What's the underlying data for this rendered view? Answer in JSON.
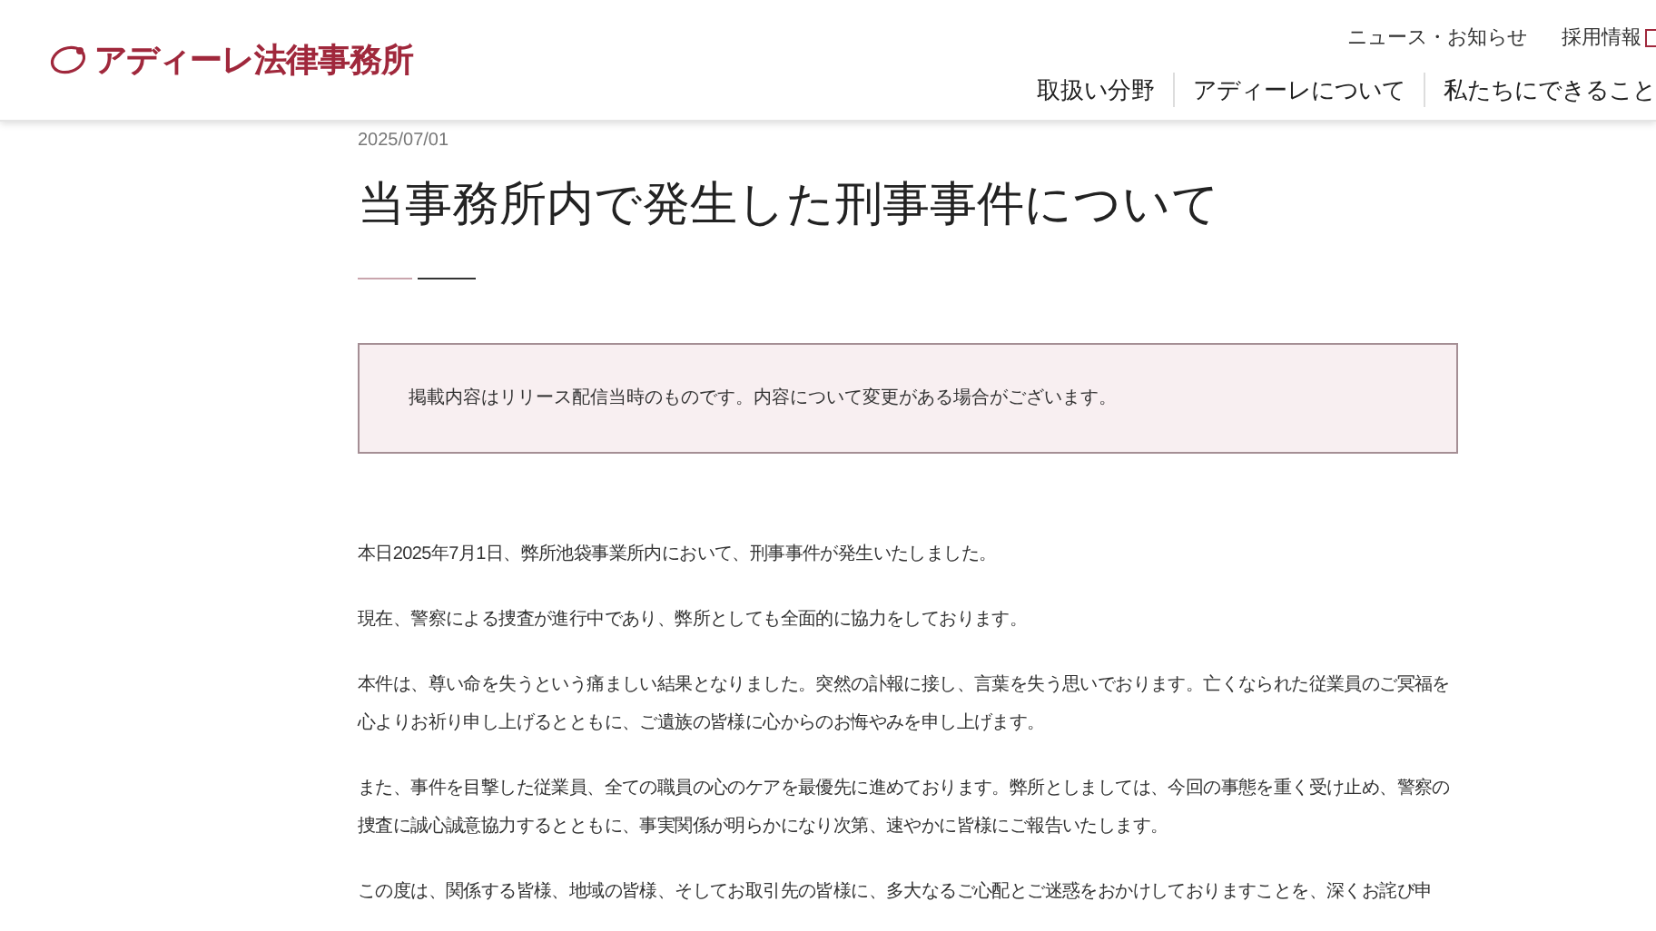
{
  "header": {
    "logo_text": "アディーレ法律事務所",
    "utility_links": [
      "ニュース・お知らせ",
      "採用情報"
    ],
    "nav": [
      "取扱い分野",
      "アディーレについて",
      "私たちにできること"
    ]
  },
  "article": {
    "date": "2025/07/01",
    "title": "当事務所内で発生した刑事事件について",
    "notice": "掲載内容はリリース配信当時のものです。内容について変更がある場合がございます。",
    "paragraphs": [
      "本日2025年7月1日、弊所池袋事業所内において、刑事事件が発生いたしました。",
      "現在、警察による捜査が進行中であり、弊所としても全面的に協力をしております。",
      "本件は、尊い命を失うという痛ましい結果となりました。突然の訃報に接し、言葉を失う思いでおります。亡くなられた従業員のご冥福を心よりお祈り申し上げるとともに、ご遺族の皆様に心からのお悔やみを申し上げます。",
      "また、事件を目撃した従業員、全ての職員の心のケアを最優先に進めております。弊所としましては、今回の事態を重く受け止め、警察の捜査に誠心誠意協力するとともに、事実関係が明らかになり次第、速やかに皆様にご報告いたします。",
      "この度は、関係する皆様、地域の皆様、そしてお取引先の皆様に、多大なるご心配とご迷惑をおかけしておりますことを、深くお詫び申"
    ]
  }
}
